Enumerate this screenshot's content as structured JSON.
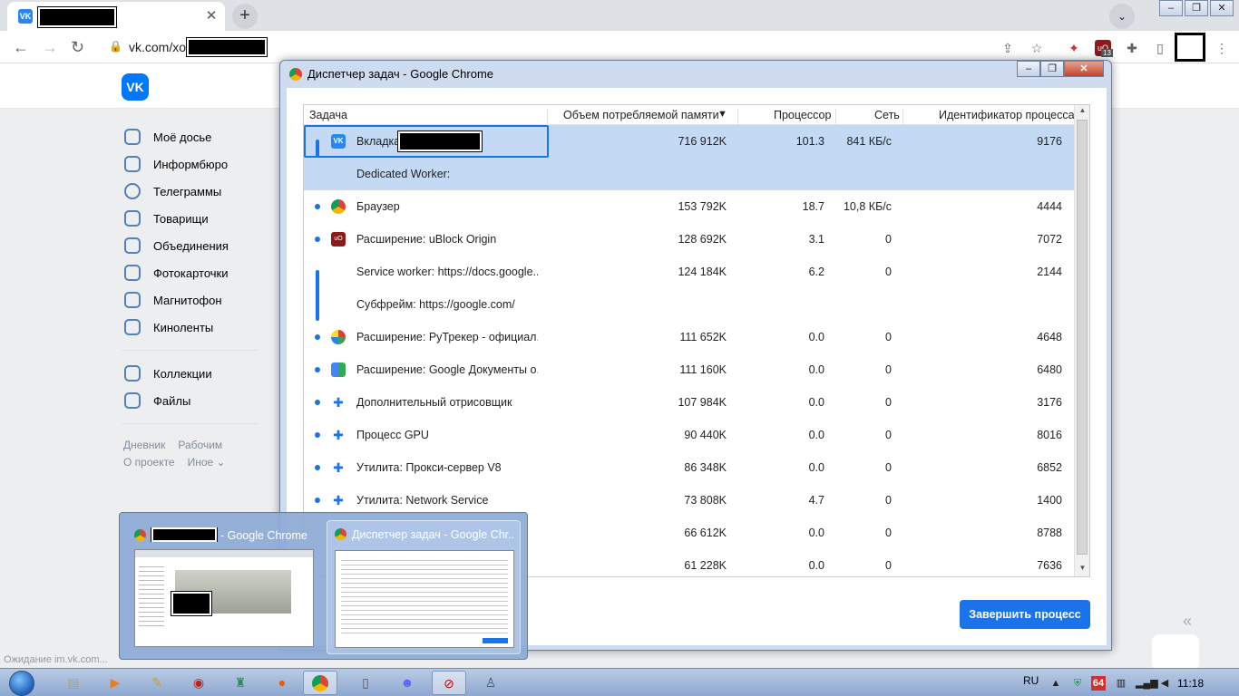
{
  "browser": {
    "address": "vk.com/xo",
    "ext_badge": "13"
  },
  "vk": {
    "nav": [
      {
        "label": "Моё досье",
        "name": "sidebar-item-profile"
      },
      {
        "label": "Информбюро",
        "name": "sidebar-item-news"
      },
      {
        "label": "Телеграммы",
        "name": "sidebar-item-messages"
      },
      {
        "label": "Товарищи",
        "name": "sidebar-item-friends"
      },
      {
        "label": "Объединения",
        "name": "sidebar-item-groups"
      },
      {
        "label": "Фотокарточки",
        "name": "sidebar-item-photos"
      },
      {
        "label": "Магнитофон",
        "name": "sidebar-item-music"
      },
      {
        "label": "Киноленты",
        "name": "sidebar-item-videos"
      }
    ],
    "nav2": [
      {
        "label": "Коллекции",
        "name": "sidebar-item-bookmarks"
      },
      {
        "label": "Файлы",
        "name": "sidebar-item-files"
      }
    ],
    "footer": {
      "blog": "Дневник",
      "jobs": "Рабочим",
      "about": "О проекте",
      "more": "Иное ⌄"
    },
    "status": "Ожидание im.vk.com..."
  },
  "task_manager": {
    "title": "Диспетчер задач - Google Chrome",
    "columns": {
      "task": "Задача",
      "memory": "Объем потребляемой памяти",
      "sort_arrow": "▼",
      "cpu": "Процессор",
      "network": "Сеть",
      "pid": "Идентификатор процесса"
    },
    "rows": [
      {
        "task": "Вкладка",
        "mem": "716 912K",
        "cpu": "101.3",
        "net": "841 КБ/с",
        "pid": "9176"
      },
      {
        "task": "Dedicated Worker:",
        "mem": "",
        "cpu": "",
        "net": "",
        "pid": ""
      },
      {
        "task": "Браузер",
        "mem": "153 792K",
        "cpu": "18.7",
        "net": "10,8 КБ/с",
        "pid": "4444"
      },
      {
        "task": "Расширение: uBlock Origin",
        "mem": "128 692K",
        "cpu": "3.1",
        "net": "0",
        "pid": "7072"
      },
      {
        "task": "Service worker: https://docs.google....",
        "mem": "124 184K",
        "cpu": "6.2",
        "net": "0",
        "pid": "2144"
      },
      {
        "task": "Субфрейм: https://google.com/",
        "mem": "",
        "cpu": "",
        "net": "",
        "pid": ""
      },
      {
        "task": "Расширение: РуТрекер - официал...",
        "mem": "111 652K",
        "cpu": "0.0",
        "net": "0",
        "pid": "4648"
      },
      {
        "task": "Расширение: Google Документы о...",
        "mem": "111 160K",
        "cpu": "0.0",
        "net": "0",
        "pid": "6480"
      },
      {
        "task": "Дополнительный отрисовщик",
        "mem": "107 984K",
        "cpu": "0.0",
        "net": "0",
        "pid": "3176"
      },
      {
        "task": "Процесс GPU",
        "mem": "90 440K",
        "cpu": "0.0",
        "net": "0",
        "pid": "8016"
      },
      {
        "task": "Утилита: Прокси-сервер V8",
        "mem": "86 348K",
        "cpu": "0.0",
        "net": "0",
        "pid": "6852"
      },
      {
        "task": "Утилита: Network Service",
        "mem": "73 808K",
        "cpu": "4.7",
        "net": "0",
        "pid": "1400"
      },
      {
        "task": "",
        "mem": "66 612K",
        "cpu": "0.0",
        "net": "0",
        "pid": "8788"
      },
      {
        "task": "",
        "mem": "61 228K",
        "cpu": "0.0",
        "net": "0",
        "pid": "7636"
      }
    ],
    "end_button": "Завершить процесс"
  },
  "thumbnails": [
    {
      "title": "- Google Chrome"
    },
    {
      "title": "Диспетчер задач - Google Chr..."
    }
  ],
  "taskbar": {
    "lang": "RU",
    "time": "11:18",
    "badge": "64"
  },
  "colors": {
    "accent": "#1a73e8",
    "vk_blue": "#0077ff",
    "selected_row": "#c3d9f4"
  }
}
